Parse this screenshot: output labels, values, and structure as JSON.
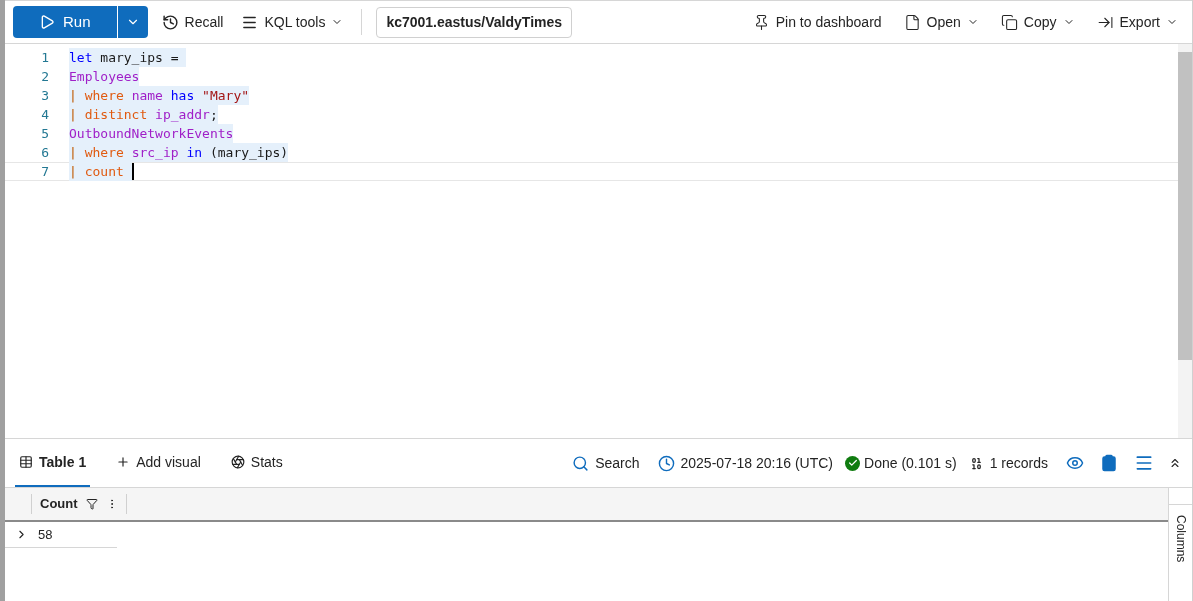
{
  "toolbar": {
    "run": "Run",
    "recall": "Recall",
    "kql_tools": "KQL tools",
    "database": "kc7001.eastus/ValdyTimes",
    "right_actions": [
      {
        "kind": "pin",
        "label": "Pin to dashboard",
        "dropdown": false
      },
      {
        "kind": "open",
        "label": "Open",
        "dropdown": true
      },
      {
        "kind": "copy",
        "label": "Copy",
        "dropdown": true
      },
      {
        "kind": "export",
        "label": "Export",
        "dropdown": true
      }
    ]
  },
  "editor": {
    "lines": [
      {
        "number": "1",
        "current": false,
        "tokens": [
          {
            "kind": "keyword",
            "text": "let"
          },
          {
            "kind": "plain",
            "text": " mary_ips = "
          }
        ]
      },
      {
        "number": "2",
        "current": false,
        "tokens": [
          {
            "kind": "table",
            "text": "Employees"
          }
        ]
      },
      {
        "number": "3",
        "current": false,
        "tokens": [
          {
            "kind": "pipe",
            "text": "| "
          },
          {
            "kind": "operator",
            "text": "where "
          },
          {
            "kind": "column",
            "text": "name "
          },
          {
            "kind": "keyword",
            "text": "has "
          },
          {
            "kind": "string",
            "text": "\"Mary\""
          }
        ]
      },
      {
        "number": "4",
        "current": false,
        "tokens": [
          {
            "kind": "pipe",
            "text": "| "
          },
          {
            "kind": "operator",
            "text": "distinct "
          },
          {
            "kind": "column",
            "text": "ip_addr"
          },
          {
            "kind": "plain",
            "text": ";"
          }
        ]
      },
      {
        "number": "5",
        "current": false,
        "tokens": [
          {
            "kind": "table",
            "text": "OutboundNetworkEvents"
          }
        ]
      },
      {
        "number": "6",
        "current": false,
        "tokens": [
          {
            "kind": "pipe",
            "text": "| "
          },
          {
            "kind": "operator",
            "text": "where "
          },
          {
            "kind": "column",
            "text": "src_ip "
          },
          {
            "kind": "keyword",
            "text": "in"
          },
          {
            "kind": "plain",
            "text": " (mary_ips)"
          }
        ]
      },
      {
        "number": "7",
        "current": true,
        "tokens": [
          {
            "kind": "pipe",
            "text": "| "
          },
          {
            "kind": "operator",
            "text": "count "
          }
        ]
      }
    ]
  },
  "results": {
    "tabs": [
      {
        "kind": "table",
        "label": "Table 1",
        "selected": true
      },
      {
        "kind": "add",
        "label": "Add visual",
        "selected": false
      },
      {
        "kind": "stats",
        "label": "Stats",
        "selected": false
      }
    ],
    "search": "Search",
    "timestamp": "2025-07-18 20:16 (UTC)",
    "status": "Done (0.101 s)",
    "records": "1 records",
    "table": {
      "columns": [
        "Count"
      ],
      "rows": [
        [
          "58"
        ]
      ]
    },
    "columns_panel": "Columns"
  }
}
